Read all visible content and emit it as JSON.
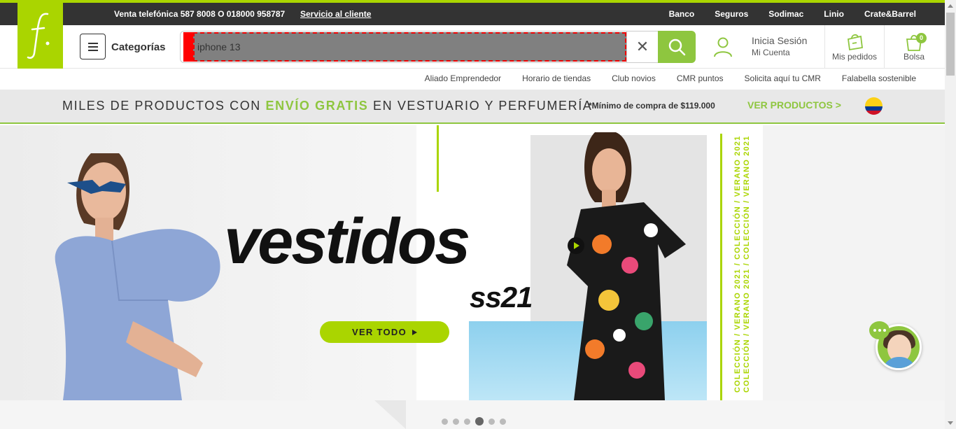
{
  "topbar": {
    "phone": "Venta telefónica 587 8008 O 018000 958787",
    "service": "Servicio al cliente",
    "links": [
      "Banco",
      "Seguros",
      "Sodimac",
      "Linio",
      "Crate&Barrel"
    ]
  },
  "header": {
    "menu_label": "Categorías",
    "search_value": "iphone 13",
    "login": "Inicia Sesión",
    "account": "Mi Cuenta",
    "orders": "Mis pedidos",
    "bag": "Bolsa",
    "bag_count": "0"
  },
  "subnav": [
    "Aliado Emprendedor",
    "Horario de tiendas",
    "Club novios",
    "CMR puntos",
    "Solicita aquí tu CMR",
    "Falabella sostenible"
  ],
  "promo": {
    "text_before": "MILES DE PRODUCTOS CON",
    "text_highlight": "ENVÍO GRATIS",
    "text_after": "EN VESTUARIO Y PERFUMERÍA",
    "minimum": "*Mínimo de compra de $119.000",
    "link": "VER PRODUCTOS >"
  },
  "hero": {
    "headline": "vestidos",
    "subline": "ss21",
    "cta": "VER TODO",
    "vertical_1": "COLECCIÓN / VERANO 2021 / COLECCIÓN / VERANO 2021",
    "vertical_2": "COLECCIÓN / VERANO 2021 / COLECCIÓN / VERANO 2021"
  },
  "carousel": {
    "total": 6,
    "active": 4
  },
  "colors": {
    "brand_green": "#aad500",
    "accent_green": "#8ec63f",
    "dark": "#333333"
  }
}
